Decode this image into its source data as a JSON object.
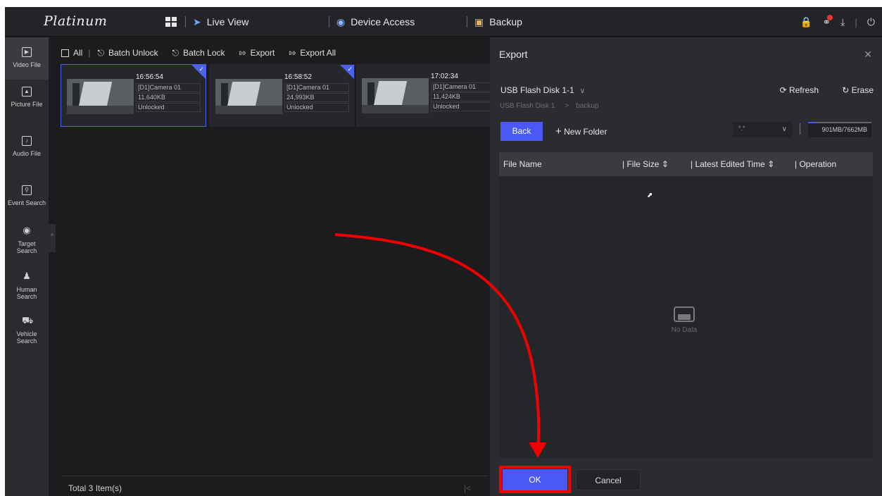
{
  "app": {
    "logo": "Platinum"
  },
  "topnav": {
    "items": [
      {
        "label": "Live View"
      },
      {
        "label": "Device Access"
      },
      {
        "label": "Backup"
      }
    ]
  },
  "sidebar": {
    "items": [
      {
        "label": "Video File",
        "icon": "video-file-icon"
      },
      {
        "label": "Picture File",
        "icon": "picture-file-icon"
      },
      {
        "label": "Audio File",
        "icon": "audio-file-icon"
      },
      {
        "label": "Event Search",
        "icon": "event-search-icon"
      },
      {
        "label": "Target Search",
        "icon": "target-search-icon"
      },
      {
        "label": "Human Search",
        "icon": "human-search-icon"
      },
      {
        "label": "Vehicle Search",
        "icon": "vehicle-search-icon"
      }
    ]
  },
  "toolbar": {
    "all": "All",
    "batch_unlock": "Batch Unlock",
    "batch_lock": "Batch Lock",
    "export": "Export",
    "export_all": "Export All"
  },
  "files": [
    {
      "time": "16:56:54",
      "camera": "[D1]Camera 01",
      "size": "11,640KB",
      "status": "Unlocked",
      "selected": true
    },
    {
      "time": "16:58:52",
      "camera": "[D1]Camera 01",
      "size": "24,993KB",
      "status": "Unlocked",
      "selected": true
    },
    {
      "time": "17:02:34",
      "camera": "[D1]Camera 01",
      "size": "11,424KB",
      "status": "Unlocked",
      "selected": false
    }
  ],
  "footer": {
    "total": "Total 3 Item(s)"
  },
  "export_panel": {
    "title": "Export",
    "device": "USB Flash Disk 1-1",
    "path_root": "USB Flash Disk 1",
    "path_folder": "backup",
    "refresh": "Refresh",
    "erase": "Erase",
    "back": "Back",
    "new_folder": "New Folder",
    "filter": "*.*",
    "capacity": "901MB/7662MB",
    "capacity_used_fraction": 0.12,
    "columns": {
      "file_name": "File Name",
      "file_size": "File Size",
      "latest_edited_time": "Latest Edited Time",
      "operation": "Operation"
    },
    "empty_text": "No Data",
    "ok": "OK",
    "cancel": "Cancel"
  },
  "colors": {
    "accent": "#4a58f5",
    "highlight": "#f20000"
  }
}
